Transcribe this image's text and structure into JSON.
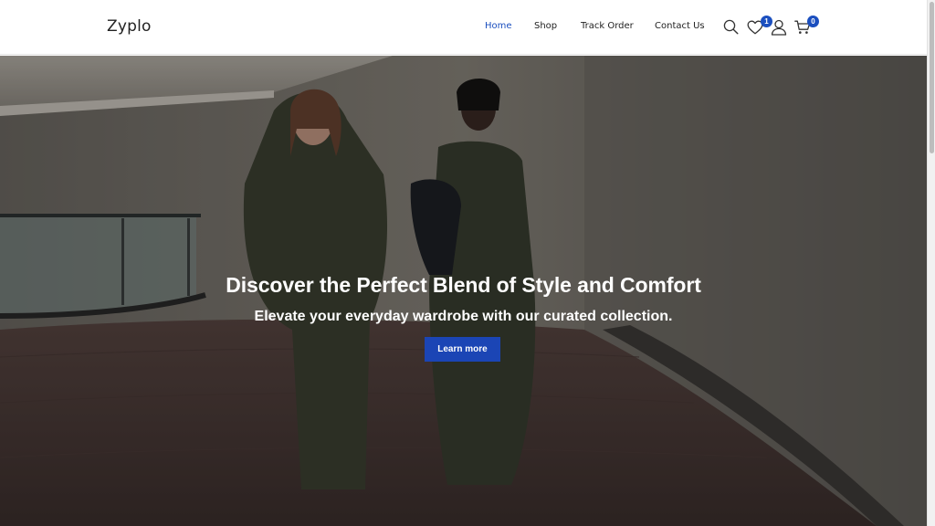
{
  "brand": {
    "logo_text": "Zyplo"
  },
  "nav": {
    "items": [
      {
        "label": "Home",
        "active": true
      },
      {
        "label": "Shop",
        "active": false
      },
      {
        "label": "Track Order",
        "active": false
      },
      {
        "label": "Contact Us",
        "active": false
      }
    ]
  },
  "header_icons": {
    "search": "search-icon",
    "wishlist": "heart-icon",
    "wishlist_count": "1",
    "account": "user-icon",
    "cart": "cart-icon",
    "cart_count": "0"
  },
  "hero": {
    "title": "Discover the Perfect Blend of Style and Comfort",
    "subtitle": "Elevate your everyday wardrobe with our curated collection.",
    "cta_label": "Learn more"
  },
  "colors": {
    "accent": "#1b4fbf",
    "button": "#1b45b5",
    "text": "#222222"
  }
}
